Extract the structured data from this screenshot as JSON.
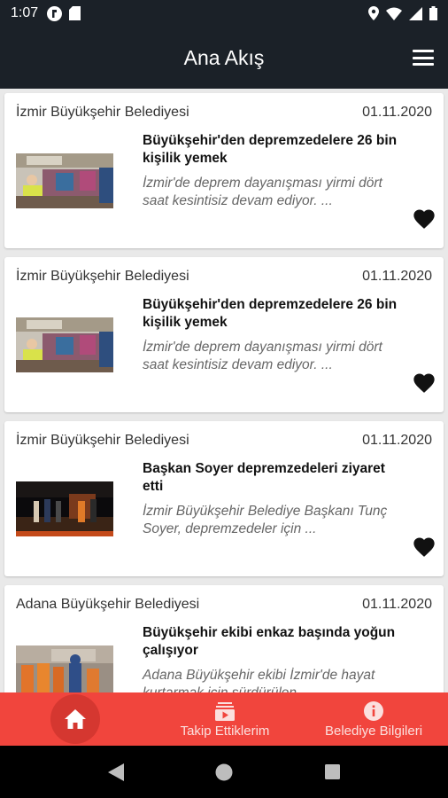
{
  "status_bar": {
    "time": "1:07"
  },
  "app_bar": {
    "title": "Ana Akış"
  },
  "cards": [
    {
      "source": "İzmir Büyükşehir Belediyesi",
      "date": "01.11.2020",
      "title": "Büyükşehir'den depremzedelere 26 bin kişilik yemek",
      "excerpt": "İzmir'de deprem dayanışması yirmi dört saat kesintisiz devam ediyor. ..."
    },
    {
      "source": "İzmir Büyükşehir Belediyesi",
      "date": "01.11.2020",
      "title": "Büyükşehir'den depremzedelere 26 bin kişilik yemek",
      "excerpt": "İzmir'de deprem dayanışması yirmi dört saat kesintisiz devam ediyor. ..."
    },
    {
      "source": "İzmir Büyükşehir Belediyesi",
      "date": "01.11.2020",
      "title": "Başkan Soyer depremzedeleri ziyaret etti",
      "excerpt": "İzmir Büyükşehir Belediye Başkanı Tunç Soyer, depremzedeler için ..."
    },
    {
      "source": "Adana Büyükşehir Belediyesi",
      "date": "01.11.2020",
      "title": "Büyükşehir ekibi enkaz başında yoğun çalışıyor",
      "excerpt": "Adana Büyükşehir ekibi İzmir'de hayat kurtarmak için sürdürülen"
    }
  ],
  "bottom_nav": {
    "follows_label": "Takip Ettiklerim",
    "info_label": "Belediye Bilgileri"
  },
  "colors": {
    "app_bar": "#1b2128",
    "accent": "#f1453d",
    "accent_dark": "#d53730"
  }
}
